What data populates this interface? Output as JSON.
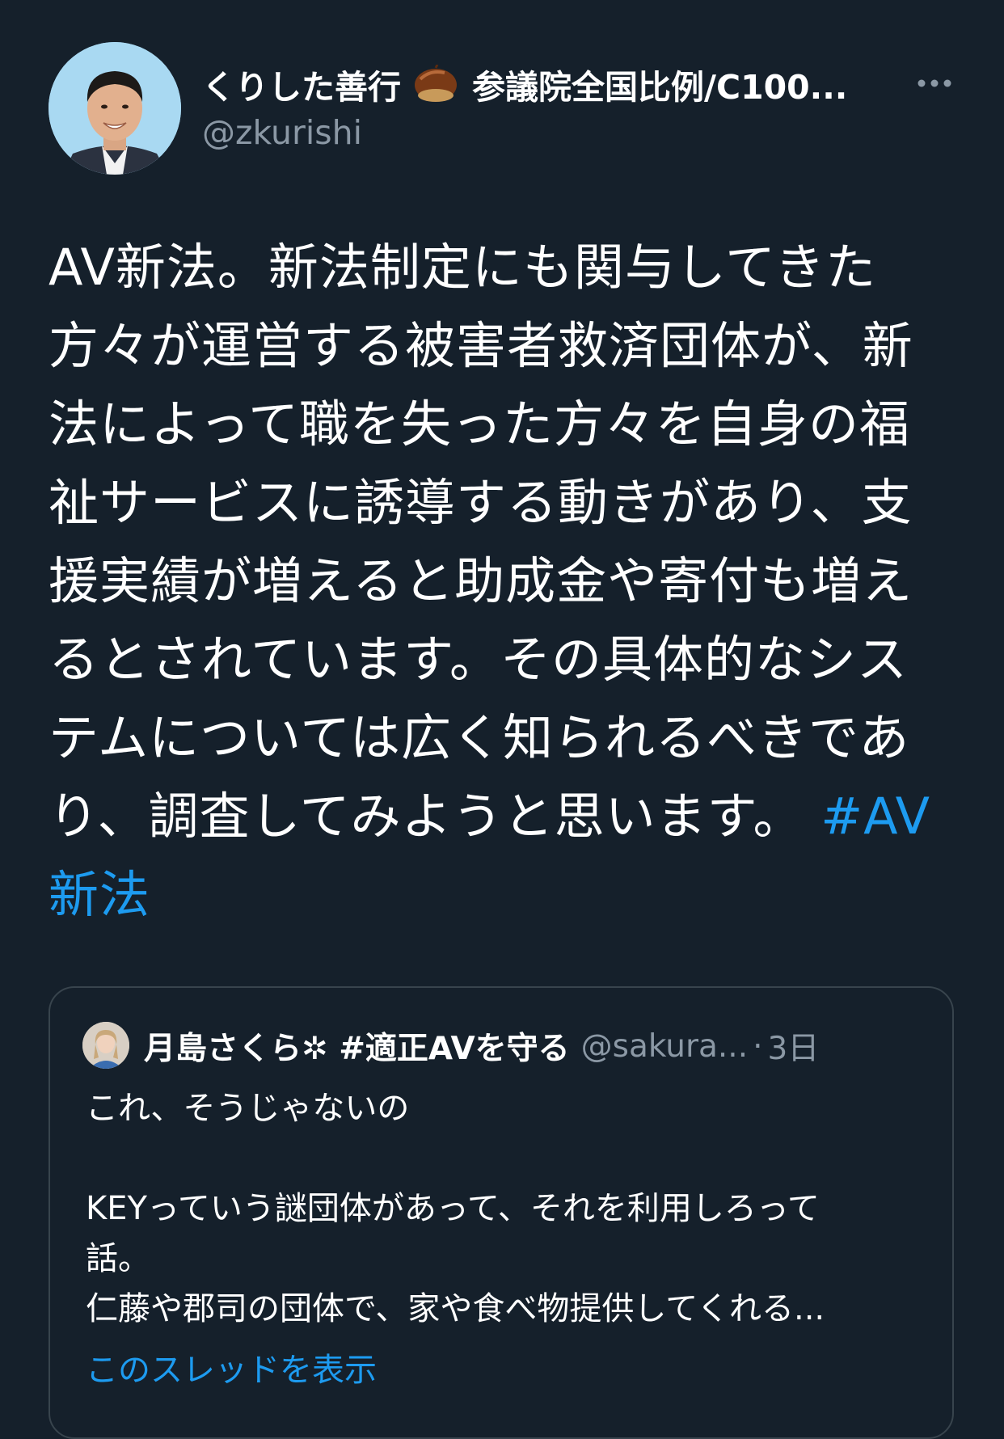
{
  "tweet": {
    "author": {
      "display_name": "くりした善行",
      "name_suffix": "参議院全国比例/C100...",
      "name_emoji_icon": "chestnut-icon",
      "handle": "@zkurishi",
      "avatar_icon": "profile-photo"
    },
    "more_icon": "more-horizontal-icon",
    "text_lines": [
      "AV新法。新法制定にも関与してきた",
      "方々が運営する被害者救済団体が、新",
      "法によって職を失った方々を自身の福",
      "祉サービスに誘導する動きがあり、支",
      "援実績が増えると助成金や寄付も増え",
      "るとされています。その具体的なシス",
      "テムについては広く知られるべきであ",
      "り、調査してみようと思います。"
    ],
    "hashtag_part1": "#AV",
    "hashtag_part2": "新法"
  },
  "quote": {
    "display_name": "月島さくら✲ #適正AVを守る",
    "handle": "@sakura...",
    "separator": "·",
    "time": "3日",
    "body_lines": [
      "これ、そうじゃないの",
      "",
      "KEYっていう謎団体があって、それを利用しろって",
      "話。",
      "仁藤や郡司の団体で、家や食べ物提供してくれる..."
    ],
    "show_thread": "このスレッドを表示"
  },
  "colors": {
    "background": "#15202b",
    "text": "#ffffff",
    "secondary": "#8b98a5",
    "link": "#1d9bf0",
    "border": "#38444d"
  }
}
